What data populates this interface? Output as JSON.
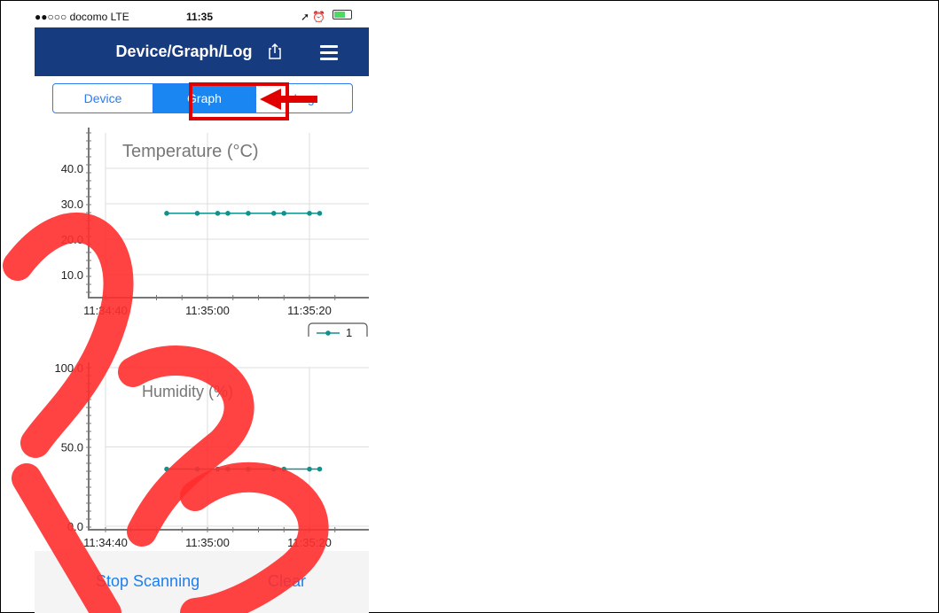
{
  "status": {
    "carrier": "●●○○○ docomo  LTE",
    "time": "11:35",
    "right_icons": "➚ ⏰"
  },
  "navbar": {
    "title": "Device/Graph/Log"
  },
  "segments": [
    {
      "label": "Device",
      "selected": false
    },
    {
      "label": "Graph",
      "selected": true
    },
    {
      "label": "Log",
      "selected": false
    }
  ],
  "chart_data": [
    {
      "type": "line",
      "title": "Temperature (°C)",
      "x": [
        "11:34:52",
        "11:34:58",
        "11:35:02",
        "11:35:04",
        "11:35:08",
        "11:35:13",
        "11:35:15",
        "11:35:20",
        "11:35:22"
      ],
      "series": [
        {
          "name": "1",
          "values": [
            27.3,
            27.3,
            27.3,
            27.3,
            27.3,
            27.3,
            27.3,
            27.3,
            27.3
          ]
        }
      ],
      "xticks": [
        "11:34:40",
        "11:35:00",
        "11:35:20"
      ],
      "yticks": [
        "10.0",
        "20.0",
        "30.0",
        "40.0"
      ],
      "ylim": [
        5,
        50
      ],
      "legend": "bottom-right",
      "grid": true
    },
    {
      "type": "line",
      "title": "Humidity (%)",
      "x": [
        "11:34:52",
        "11:34:58",
        "11:35:02",
        "11:35:04",
        "11:35:08",
        "11:35:13",
        "11:35:15",
        "11:35:20",
        "11:35:22"
      ],
      "series": [
        {
          "name": "1",
          "values": [
            36,
            36,
            36,
            36,
            36,
            36,
            36,
            36,
            36
          ]
        }
      ],
      "xticks": [
        "11:34:40",
        "11:35:00",
        "11:35:20"
      ],
      "yticks": [
        "0.0",
        "50.0",
        "100.0"
      ],
      "ylim": [
        0,
        100
      ],
      "grid": true
    }
  ],
  "bottom": {
    "stop_label": "Stop Scanning",
    "clear_label": "Clear"
  },
  "colors": {
    "nav": "#173b7f",
    "accent": "#1a86f2",
    "series": "#12908a",
    "highlight": "#e10000",
    "watermark": "#ff2d2d"
  },
  "icons": {
    "share": "share-icon",
    "menu": "hamburger-menu-icon",
    "arrow": "red-arrow-icon"
  }
}
